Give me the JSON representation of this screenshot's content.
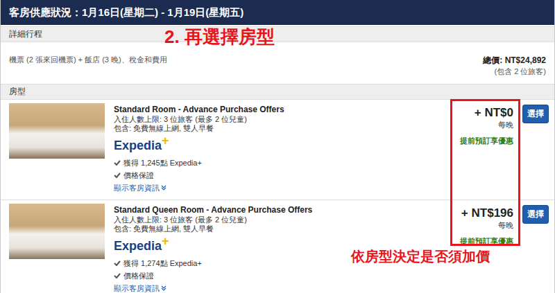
{
  "header": {
    "title": "客房供應狀況：1月16日(星期二) - 1月19日(星期五)"
  },
  "annotations": [
    {
      "text": "2. 再選擇房型"
    },
    {
      "text": "依房型決定是否須加價"
    }
  ],
  "itinerary": {
    "label": "詳細行程",
    "description": "機票 (2 張來回機票) + 飯店 (3 晚)、稅金和費用",
    "total": "總價: NT$24,892",
    "travelers": "(包含 2 位旅客)"
  },
  "rooms_section": {
    "label": "房型",
    "rooms": [
      {
        "name": "Standard Room - Advance Purchase Offers",
        "occupancy": "入住人數上限: 3 位旅客 (最多 2 位兒童)",
        "includes": "包含: 免費無線上網, 雙人早餐",
        "brand": "Expedia",
        "brand_mark": "+",
        "points": "獲得 1,245點 Expedia+",
        "guarantee": "價格保證",
        "details_link": "顯示客房資訊",
        "price": "+ NT$0",
        "per_night": "每晚",
        "deal": "提前預訂享優惠",
        "button": "選擇"
      },
      {
        "name": "Standard Queen Room - Advance Purchase Offers",
        "occupancy": "入住人數上限: 3 位旅客 (最多 2 位兒童)",
        "includes": "包含: 免費無線上網, 雙人早餐",
        "brand": "Expedia",
        "brand_mark": "+",
        "points": "獲得 1,274點 Expedia+",
        "guarantee": "價格保證",
        "details_link": "顯示客房資訊",
        "price": "+ NT$196",
        "per_night": "每晚",
        "deal": "提前預訂享優惠",
        "button": "選擇"
      }
    ]
  }
}
